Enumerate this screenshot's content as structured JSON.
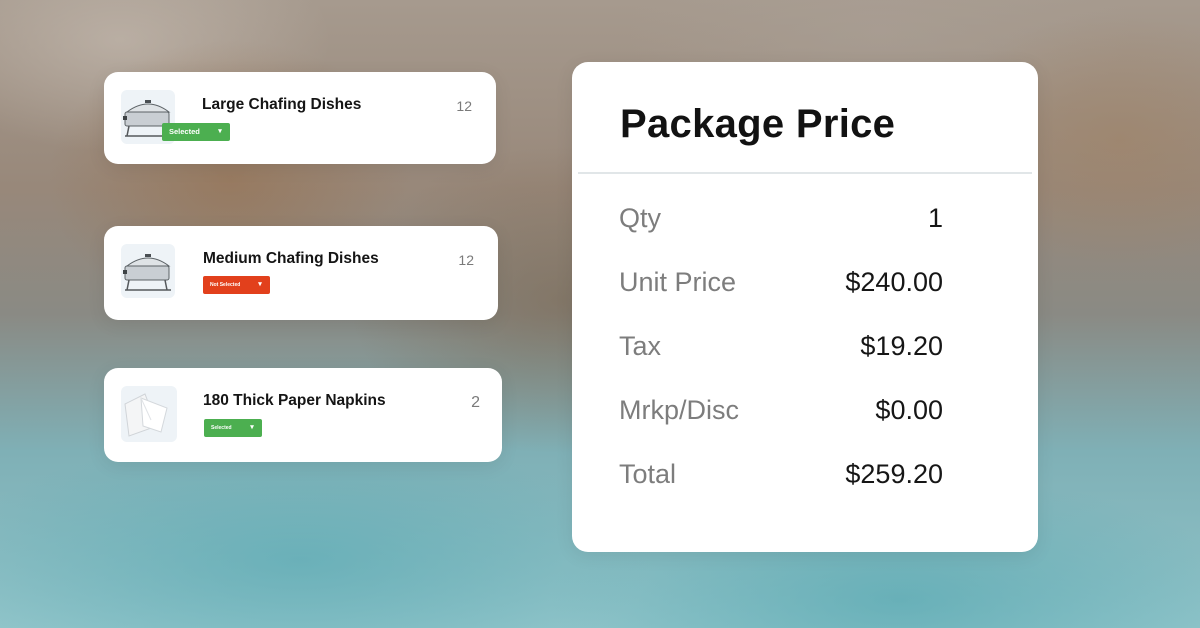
{
  "items": [
    {
      "name": "Large Chafing Dishes",
      "qty": "12",
      "status": "Selected",
      "status_color": "#4caf50"
    },
    {
      "name": "Medium Chafing Dishes",
      "qty": "12",
      "status": "Not Selected",
      "status_color": "#e2401c"
    },
    {
      "name": "180 Thick Paper Napkins",
      "qty": "2",
      "status": "Selected",
      "status_color": "#4caf50"
    }
  ],
  "icons": {
    "item_0": "chafing-dish-icon",
    "item_1": "chafing-dish-icon",
    "item_2": "paper-napkin-icon",
    "dropdown": "chevron-down-icon"
  },
  "package": {
    "title": "Package Price",
    "rows": [
      {
        "label": "Qty",
        "value": "1"
      },
      {
        "label": "Unit Price",
        "value": "$240.00"
      },
      {
        "label": "Tax",
        "value": "$19.20"
      },
      {
        "label": "Mrkp/Disc",
        "value": "$0.00"
      },
      {
        "label": "Total",
        "value": "$259.20"
      }
    ]
  }
}
